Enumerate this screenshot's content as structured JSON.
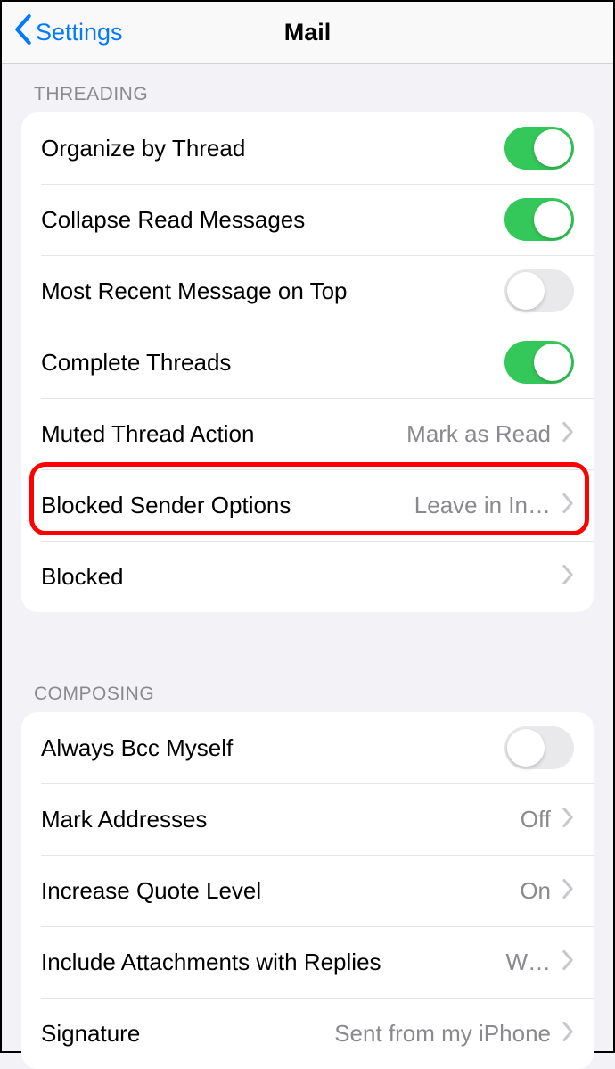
{
  "nav": {
    "back": "Settings",
    "title": "Mail"
  },
  "sections": {
    "threading": {
      "header": "THREADING",
      "rows": {
        "organize": {
          "label": "Organize by Thread",
          "on": true
        },
        "collapse": {
          "label": "Collapse Read Messages",
          "on": true
        },
        "recent": {
          "label": "Most Recent Message on Top",
          "on": false
        },
        "complete": {
          "label": "Complete Threads",
          "on": true
        },
        "muted": {
          "label": "Muted Thread Action",
          "value": "Mark as Read"
        },
        "blockedopt": {
          "label": "Blocked Sender Options",
          "value": "Leave in In…"
        },
        "blocked": {
          "label": "Blocked"
        }
      }
    },
    "composing": {
      "header": "COMPOSING",
      "rows": {
        "bcc": {
          "label": "Always Bcc Myself",
          "on": false
        },
        "mark": {
          "label": "Mark Addresses",
          "value": "Off"
        },
        "quote": {
          "label": "Increase Quote Level",
          "value": "On"
        },
        "attach": {
          "label": "Include Attachments with Replies",
          "value": "W…"
        },
        "signature": {
          "label": "Signature",
          "value": "Sent from my iPhone"
        }
      }
    }
  }
}
